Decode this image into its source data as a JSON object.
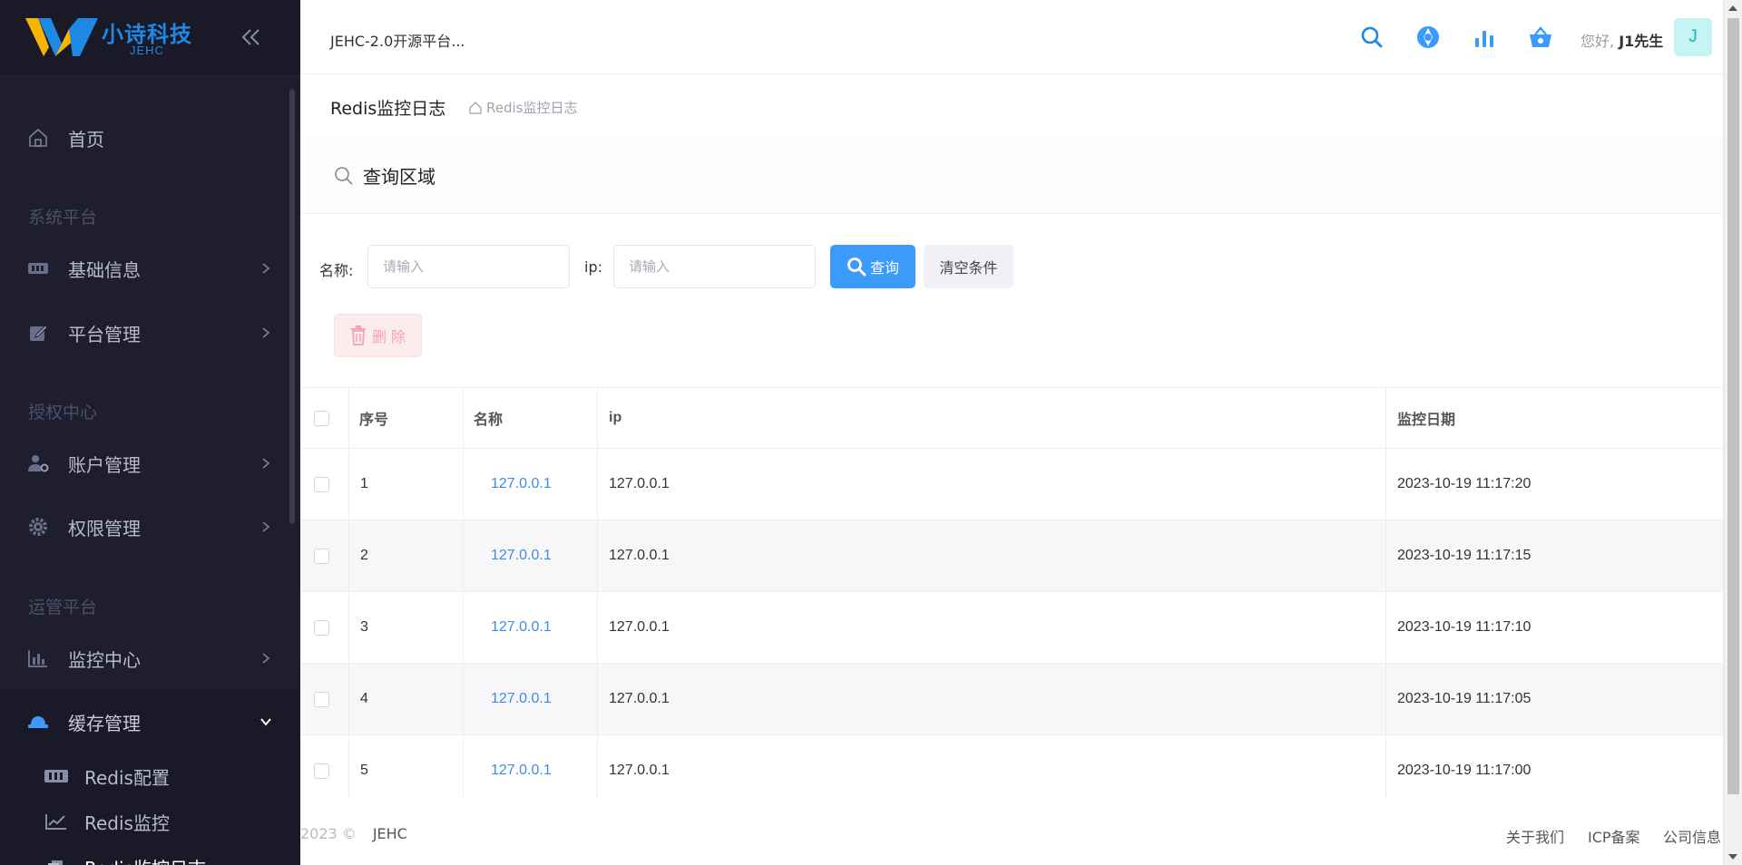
{
  "brand": {
    "name": "小诗科技",
    "sub": "JEHC",
    "color_primary": "#1e88e5",
    "color_accent": "#f7b500"
  },
  "sidebar": {
    "collapse_icon": "double-chevron-left-icon",
    "items": [
      {
        "label": "首页",
        "icon": "home-icon"
      },
      {
        "group": "系统平台"
      },
      {
        "label": "基础信息",
        "icon": "id-card-icon"
      },
      {
        "label": "平台管理",
        "icon": "edit-icon"
      },
      {
        "group": "授权中心"
      },
      {
        "label": "账户管理",
        "icon": "user-gear-icon"
      },
      {
        "label": "权限管理",
        "icon": "cog-icon"
      },
      {
        "group": "运管平台"
      },
      {
        "label": "监控中心",
        "icon": "bar-chart-icon"
      },
      {
        "label": "缓存管理",
        "icon": "cloud-server-icon"
      }
    ],
    "sub_items": [
      {
        "label": "Redis配置",
        "icon": "id-card-icon"
      },
      {
        "label": "Redis监控",
        "icon": "line-chart-icon"
      },
      {
        "label": "Redis监控日志",
        "icon": "layers-icon"
      }
    ]
  },
  "header": {
    "app_title": "JEHC-2.0开源平台...",
    "icons": [
      "search-icon",
      "aperture-icon",
      "signal-bars-icon",
      "basket-icon"
    ],
    "greeting_prefix": "您好,",
    "user_name": "J1先生",
    "avatar_letter": "J"
  },
  "page": {
    "title": "Redis监控日志",
    "breadcrumb": "Redis监控日志"
  },
  "search": {
    "section_title": "查询区域",
    "name_label": "名称:",
    "name_placeholder": "请输入",
    "ip_label": "ip:",
    "ip_placeholder": "请输入",
    "query_button": "查询",
    "clear_button": "清空条件",
    "delete_button": "删 除"
  },
  "table": {
    "columns": [
      "序号",
      "名称",
      "ip",
      "监控日期"
    ],
    "rows": [
      {
        "no": "1",
        "name": "127.0.0.1",
        "ip": "127.0.0.1",
        "date": "2023-10-19 11:17:20"
      },
      {
        "no": "2",
        "name": "127.0.0.1",
        "ip": "127.0.0.1",
        "date": "2023-10-19 11:17:15"
      },
      {
        "no": "3",
        "name": "127.0.0.1",
        "ip": "127.0.0.1",
        "date": "2023-10-19 11:17:10"
      },
      {
        "no": "4",
        "name": "127.0.0.1",
        "ip": "127.0.0.1",
        "date": "2023-10-19 11:17:05"
      },
      {
        "no": "5",
        "name": "127.0.0.1",
        "ip": "127.0.0.1",
        "date": "2023-10-19 11:17:00"
      }
    ]
  },
  "footer": {
    "copyright": "2023 ©",
    "brand": "JEHC",
    "links": [
      "关于我们",
      "ICP备案",
      "公司信息"
    ]
  },
  "colors": {
    "sidebar_bg": "#1e1e2f",
    "primary_button": "#3a9bfb",
    "link": "#3a8ee6",
    "danger_light": "#fdecee"
  }
}
